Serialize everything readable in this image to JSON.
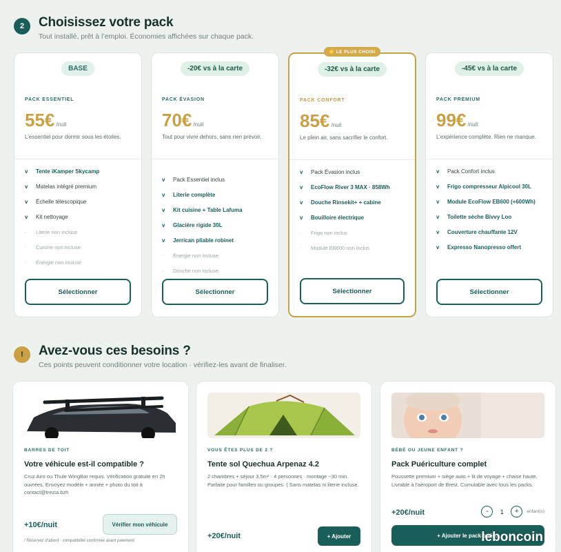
{
  "step1": {
    "number": "2",
    "title": "Choisissez votre pack",
    "subtitle": "Tout installé, prêt à l’emploi. Économies affichées sur chaque pack."
  },
  "packs": [
    {
      "pill": "BASE",
      "name": "PACK ESSENTIEL",
      "price": "55€",
      "unit": "/nuit",
      "desc": "L’essentiel pour dormir sous les étoiles.",
      "features": [
        {
          "mark": "v",
          "text": "Tente iKamper Skycamp",
          "style": "bold"
        },
        {
          "mark": "v",
          "text": "Matelas intégré premium",
          "style": "reg"
        },
        {
          "mark": "v",
          "text": "Échelle télescopique",
          "style": "reg"
        },
        {
          "mark": "v",
          "text": "Kit nettoyage",
          "style": "reg"
        },
        {
          "mark": "·",
          "text": "Literie non incluse",
          "style": "off"
        },
        {
          "mark": "·",
          "text": "Cuisine non incluse",
          "style": "off"
        },
        {
          "mark": "·",
          "text": "Énergie non incluse",
          "style": "off"
        }
      ],
      "button": "Sélectionner"
    },
    {
      "pill": "-20€ vs à la carte",
      "name": "PACK ÉVASION",
      "price": "70€",
      "unit": "/nuit",
      "desc": "Tout pour vivre dehors, sans rien prévoir.",
      "features": [
        {
          "mark": "v",
          "text": "Pack Essentiel inclus",
          "style": "reg"
        },
        {
          "mark": "v",
          "text": "Literie complète",
          "style": "bold"
        },
        {
          "mark": "v",
          "text": "Kit cuisine + Table Lafuma",
          "style": "bold"
        },
        {
          "mark": "v",
          "text": "Glacière rigide 30L",
          "style": "bold"
        },
        {
          "mark": "v",
          "text": "Jerrican pliable robinet",
          "style": "bold"
        },
        {
          "mark": "·",
          "text": "Énergie non incluse",
          "style": "off"
        },
        {
          "mark": "·",
          "text": "Douche non incluse",
          "style": "off"
        }
      ],
      "button": "Sélectionner"
    },
    {
      "badge": "⭐ LE PLUS CHOISI",
      "pill": "-32€ vs à la carte",
      "name": "PACK CONFORT",
      "price": "85€",
      "unit": "/nuit",
      "desc": "Le plein air, sans sacrifier le confort.",
      "features": [
        {
          "mark": "v",
          "text": "Pack Évasion inclus",
          "style": "reg"
        },
        {
          "mark": "v",
          "text": "EcoFlow River 3 MAX · 858Wh",
          "style": "bold"
        },
        {
          "mark": "v",
          "text": "Douche Rinsekit+ + cabine",
          "style": "bold"
        },
        {
          "mark": "v",
          "text": "Bouilloire électrique",
          "style": "bold"
        },
        {
          "mark": "·",
          "text": "Frigo non inclus",
          "style": "off"
        },
        {
          "mark": "·",
          "text": "Module EB600 non inclus",
          "style": "off"
        }
      ],
      "button": "Sélectionner"
    },
    {
      "pill": "-45€ vs à la carte",
      "name": "PACK PREMIUM",
      "price": "99€",
      "unit": "/nuit",
      "desc": "L’expérience complète. Rien ne manque.",
      "features": [
        {
          "mark": "v",
          "text": "Pack Confort inclus",
          "style": "reg"
        },
        {
          "mark": "v",
          "text": "Frigo compresseur Alpicool 30L",
          "style": "bold"
        },
        {
          "mark": "v",
          "text": "Module EcoFlow EB600 (+600Wh)",
          "style": "bold"
        },
        {
          "mark": "v",
          "text": "Toilette sèche Bivvy Loo",
          "style": "bold"
        },
        {
          "mark": "v",
          "text": "Couverture chauffante 12V",
          "style": "bold"
        },
        {
          "mark": "v",
          "text": "Expresso Nanopresso offert",
          "style": "bold"
        }
      ],
      "button": "Sélectionner"
    }
  ],
  "step2": {
    "number": "!",
    "title": "Avez-vous ces besoins ?",
    "subtitle": "Ces points peuvent conditionner votre location · vérifiez-les avant de finaliser."
  },
  "needs": [
    {
      "tag": "BARRES DE TOIT",
      "title": "Votre véhicule est-il compatible ?",
      "desc": "Cruz Airo ou Thule WingBar requis. Vérification gratuite en 2h ouvrées. Envoyez modèle + année + photo du toit à contact@trezia.bzh",
      "price": "+10€/nuit",
      "button": "Vérifier mon véhicule",
      "note": "! Réservez d’abord · compatibilité confirmée avant paiement."
    },
    {
      "tag": "VOUS ÊTES PLUS DE 2 ?",
      "title": "Tente sol Quechua Arpenaz 4.2",
      "desc": "2 chambres + séjour 3,5m² · 4 personnes · montage ~30 min. Parfaite pour familles ou groupes. ( Sans matelas ni literie incluse.",
      "price": "+20€/nuit",
      "button": "+ Ajouter"
    },
    {
      "tag": "BÉBÉ OU JEUNE ENFANT ?",
      "title": "Pack Puériculture complet",
      "desc": "Poussette premium + siège auto + lit de voyage + chaise haute. Livrable à l’aéroport de Brest. Cumulable avec tous les packs.",
      "price": "+20€/nuit",
      "stepper": {
        "minus": "-",
        "value": "1",
        "plus": "+",
        "unit": "enfant(s)"
      },
      "button": "+ Ajouter le pack puér..."
    }
  ],
  "watermark": "leboncoin",
  "colors": {
    "teal": "#1a5e5a",
    "gold": "#c9a043",
    "bg": "#eef2ef"
  }
}
